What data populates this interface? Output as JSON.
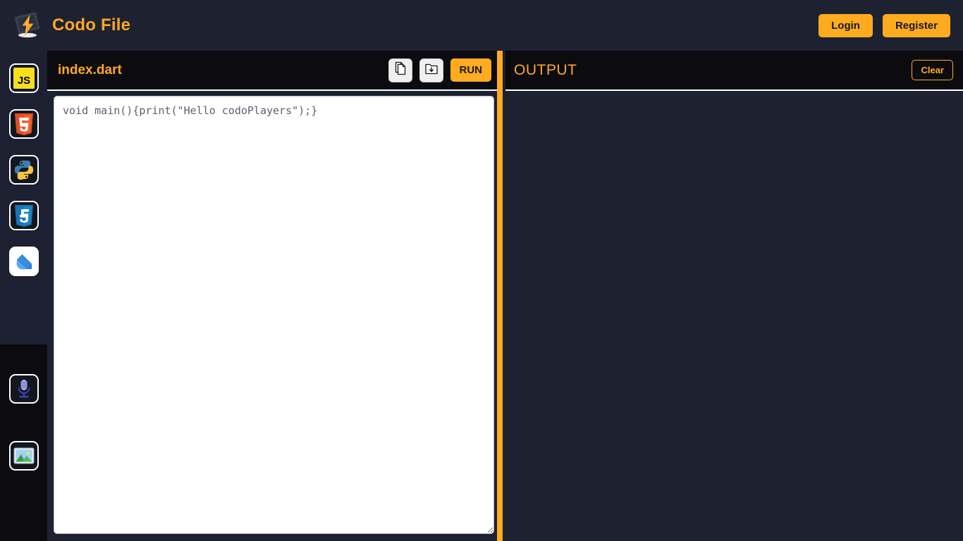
{
  "navbar": {
    "brand_title": "Codo File",
    "logo_icon": "lightning-bolt-logo",
    "login_label": "Login",
    "register_label": "Register",
    "accent_color": "#ffa726",
    "button_color": "#ffab20",
    "background_color": "#1e2130"
  },
  "sidebar": {
    "language_items": [
      {
        "name": "javascript",
        "label": "JS",
        "icon": "javascript-icon"
      },
      {
        "name": "html5",
        "label": "5",
        "icon": "html5-icon"
      },
      {
        "name": "python",
        "label": "",
        "icon": "python-icon"
      },
      {
        "name": "css3",
        "label": "3",
        "icon": "css3-icon"
      },
      {
        "name": "dart",
        "label": "",
        "icon": "dart-icon"
      }
    ],
    "tool_items": [
      {
        "name": "microphone",
        "label": "",
        "icon": "microphone-icon"
      },
      {
        "name": "image",
        "label": "",
        "icon": "image-icon"
      }
    ]
  },
  "editor": {
    "filename": "index.dart",
    "copy_icon": "copy-icon",
    "save_icon": "save-to-folder-icon",
    "run_label": "RUN",
    "code": "void main(){print(\"Hello codoPlayers\");}",
    "code_placeholder": ""
  },
  "output": {
    "title": "OUTPUT",
    "clear_label": "Clear",
    "console_text": ""
  }
}
